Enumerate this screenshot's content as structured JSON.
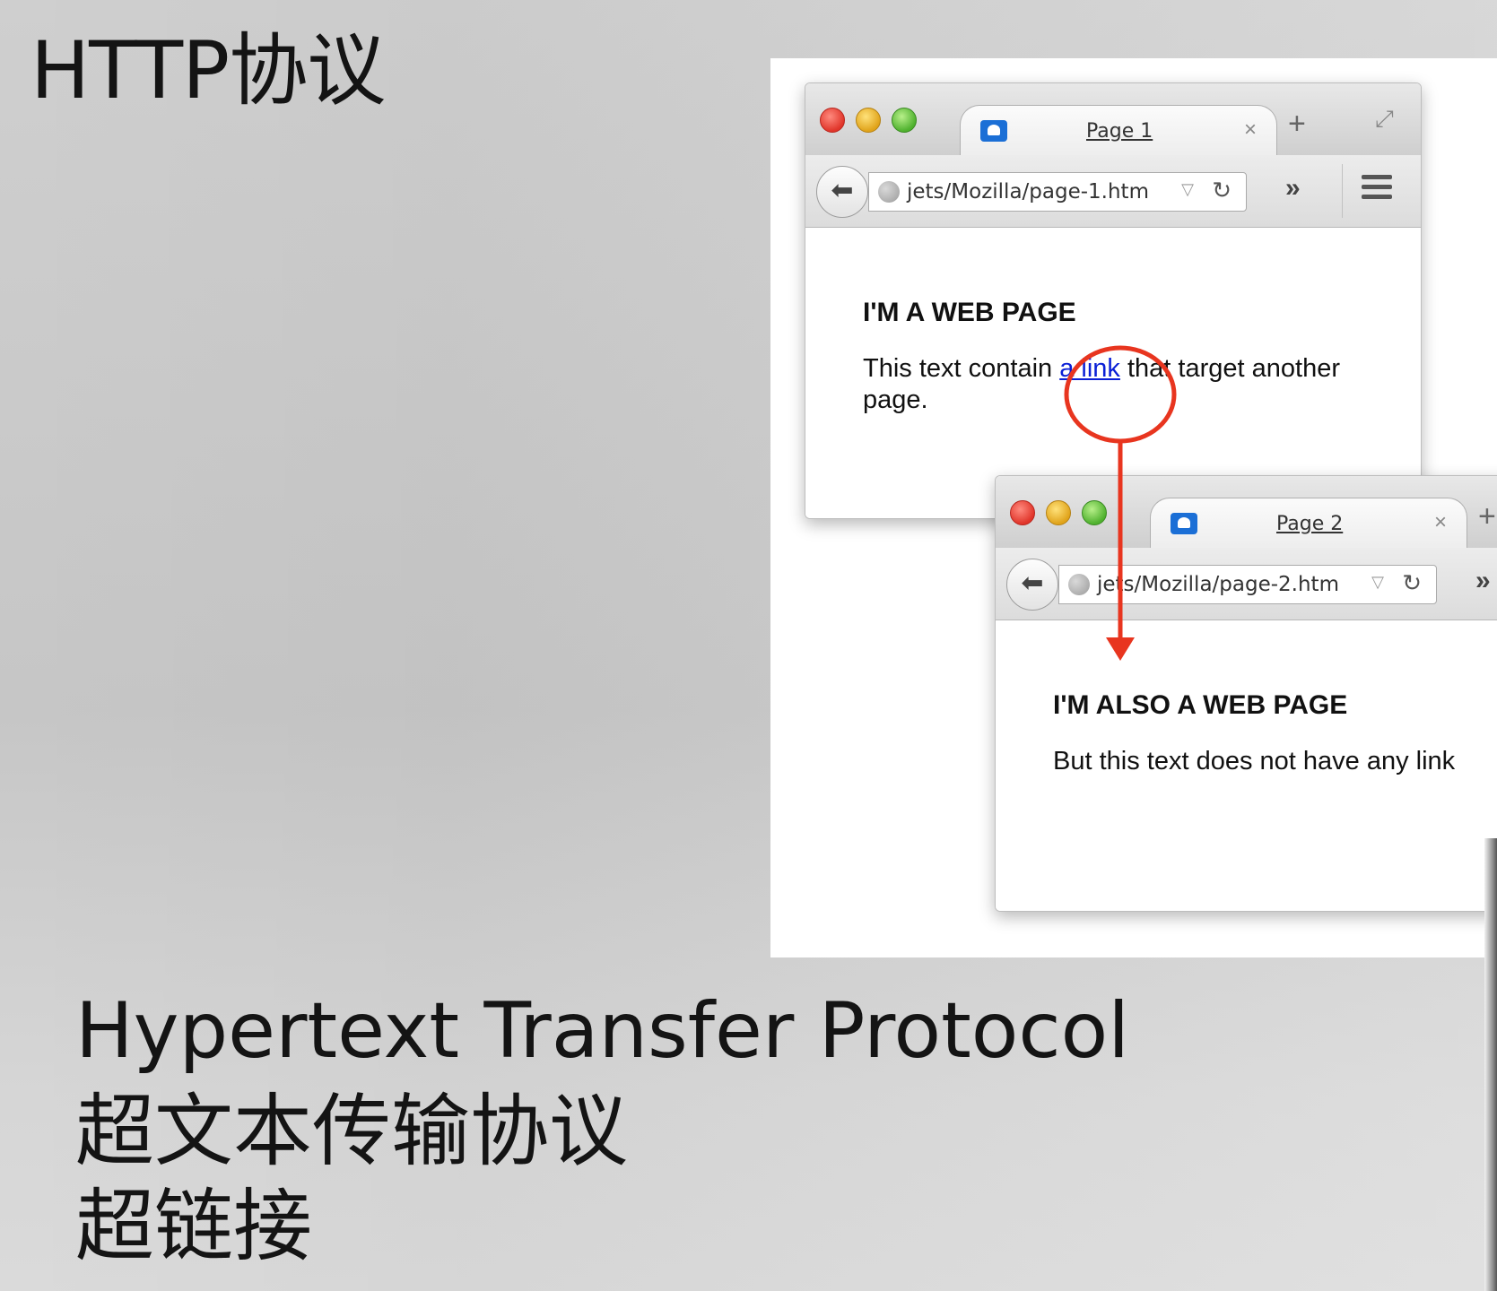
{
  "slide": {
    "title": "HTTP协议",
    "caption_en": "Hypertext Transfer Protocol",
    "caption_cn": "超文本传输协议",
    "caption_cn2": "超链接"
  },
  "illustration": {
    "annotation_color": "#e8351f",
    "browser1": {
      "tab_title": "Page 1",
      "tab_close": "×",
      "new_tab": "+",
      "url": "jets/Mozilla/page-1.htm",
      "heading": "I'M A WEB PAGE",
      "text_before_link": "This text contain ",
      "link_text": "a link",
      "text_after_link": " that target another page."
    },
    "browser2": {
      "tab_title": "Page 2",
      "tab_close": "×",
      "new_tab": "+",
      "url": "jets/Mozilla/page-2.htm",
      "heading": "I'M ALSO A WEB PAGE",
      "text": "But this text does not have any link"
    }
  }
}
